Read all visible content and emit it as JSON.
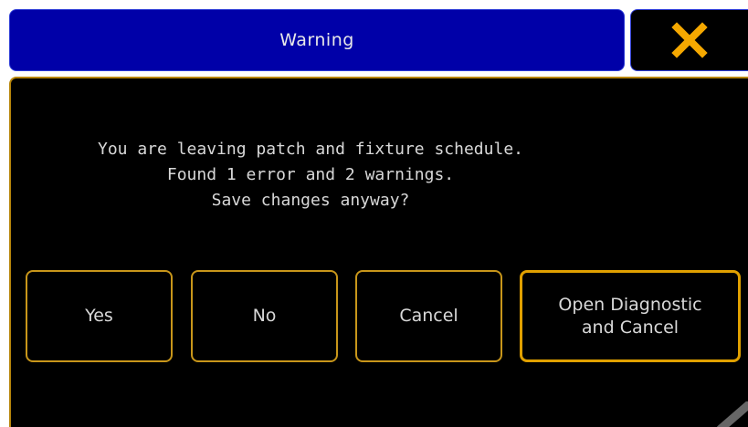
{
  "dialog": {
    "title": "Warning",
    "close_icon": "close-x-icon",
    "message_lines": [
      "You are leaving patch and fixture schedule.",
      "Found 1 error and 2 warnings.",
      "Save changes anyway?"
    ],
    "buttons": {
      "yes": "Yes",
      "no": "No",
      "cancel": "Cancel",
      "open_diagnostic": "Open Diagnostic\nand Cancel"
    }
  },
  "colors": {
    "title_bar": "#0000a8",
    "border_accent": "#c8961a",
    "close_icon": "#f5a800",
    "background": "#000000",
    "text": "#d8d8d8"
  }
}
